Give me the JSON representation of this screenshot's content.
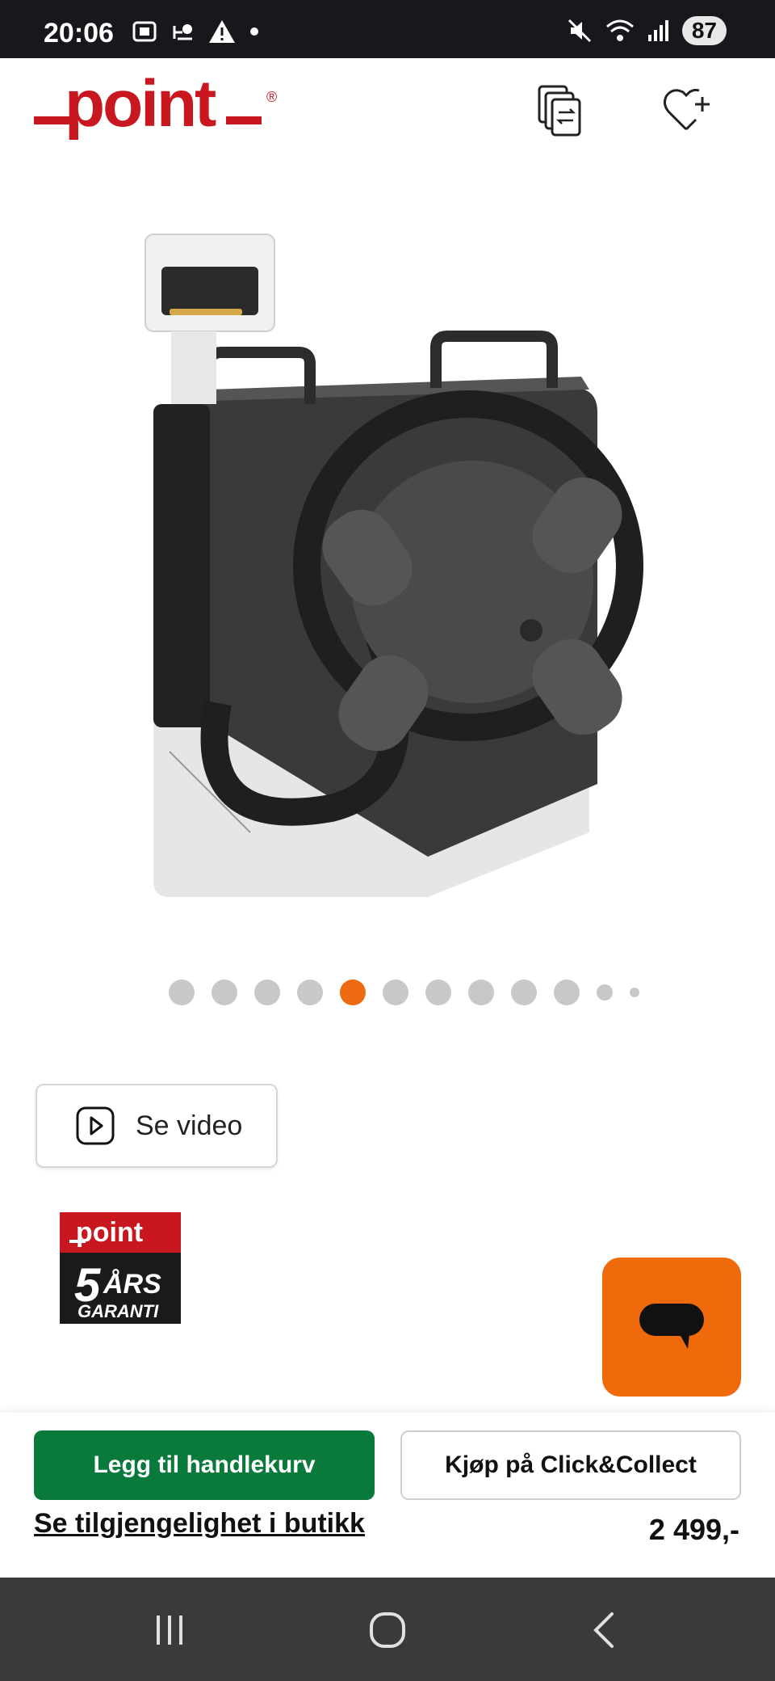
{
  "status_bar": {
    "time": "20:06",
    "battery": "87",
    "icons_left": [
      "screenshot-icon",
      "weather-icon",
      "warning-icon",
      "dot-icon"
    ],
    "icons_right": [
      "mute-icon",
      "wifi-icon",
      "signal-icon",
      "battery-icon"
    ]
  },
  "header": {
    "logo_text": "point",
    "logo_mark": "®",
    "compare_icon": "compare-icon",
    "wishlist_icon": "heart-plus-icon"
  },
  "carousel": {
    "total_dots": 12,
    "active_index": 4
  },
  "video_button": {
    "label": "Se video",
    "icon": "play-icon"
  },
  "guarantee_badge": {
    "brand": "point",
    "years": "5",
    "line1": "ÅRS",
    "line2": "GARANTI"
  },
  "chat_button": {
    "icon": "chat-icon"
  },
  "purchase": {
    "add_to_cart_label": "Legg til handlekurv",
    "click_collect_label": "Kjøp på Click&Collect",
    "store_availability_label": "Se tilgjengelighet i butikk",
    "price": "2 499,-"
  },
  "nav_bar": {
    "recents_icon": "recents-icon",
    "home_icon": "home-icon",
    "back_icon": "back-icon"
  },
  "colors": {
    "brand_red": "#c8171e",
    "accent_orange": "#ee6a12",
    "cart_green": "#0a7a3c"
  }
}
